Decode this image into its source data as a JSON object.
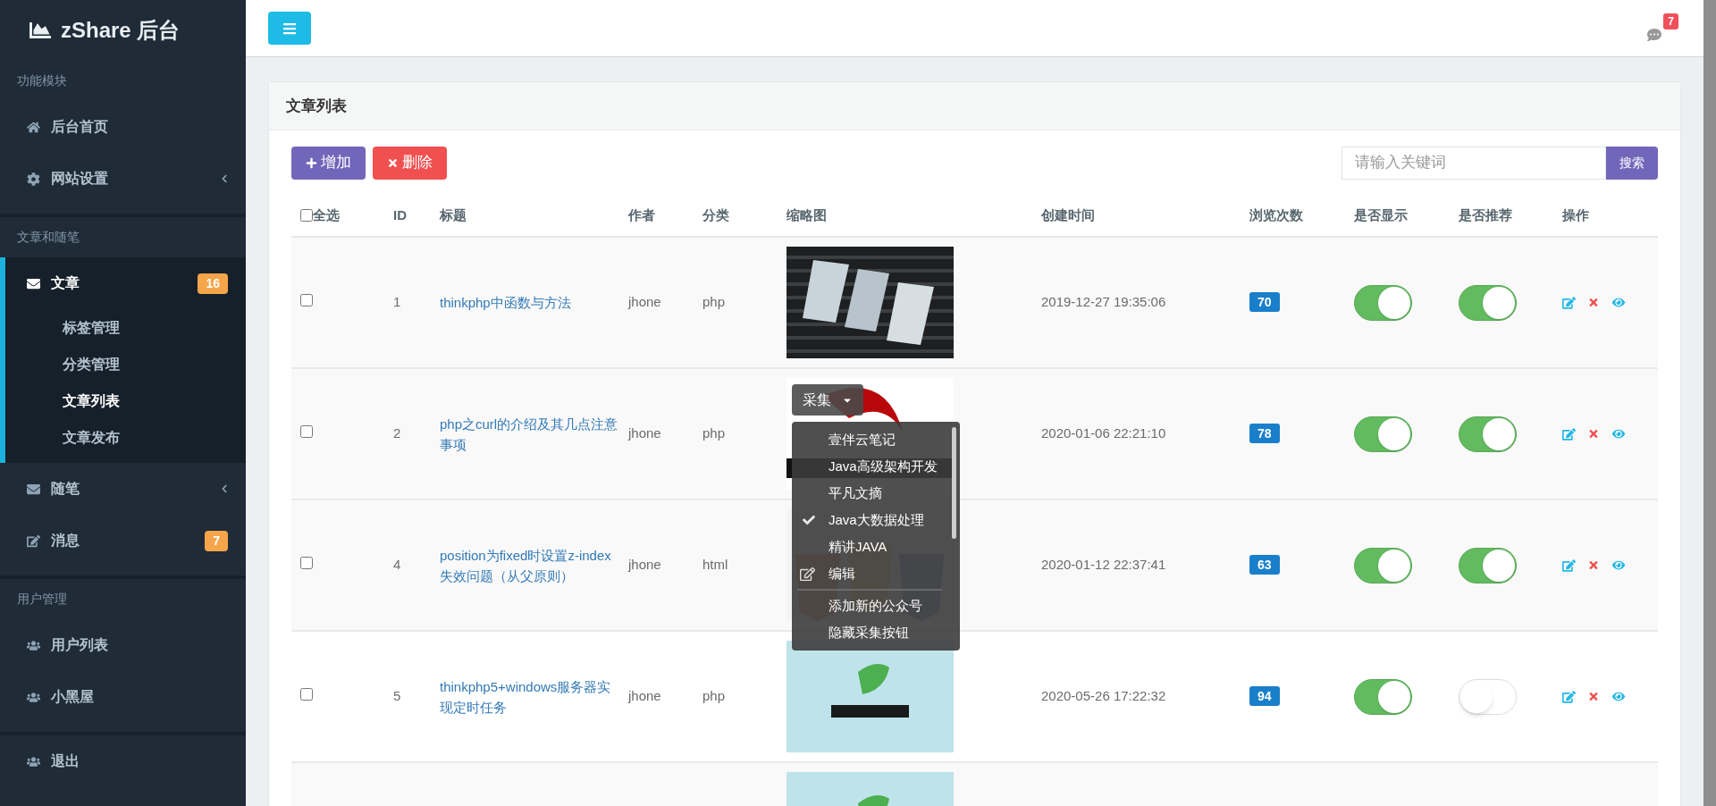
{
  "sidebar": {
    "logo": "zShare 后台",
    "sections": [
      {
        "label": "功能模块",
        "items": [
          {
            "label": "后台首页"
          },
          {
            "label": "网站设置",
            "expanded": false
          }
        ]
      },
      {
        "label": "文章和随笔",
        "items": [
          {
            "label": "文章",
            "expanded": true,
            "badge": "16",
            "children": [
              {
                "label": "标签管理",
                "selected": false
              },
              {
                "label": "分类管理",
                "selected": false
              },
              {
                "label": "文章列表",
                "selected": true
              },
              {
                "label": "文章发布",
                "selected": false
              }
            ]
          },
          {
            "label": "随笔",
            "expanded": false
          },
          {
            "label": "消息",
            "badge": "7"
          }
        ]
      },
      {
        "label": "用户管理",
        "items": [
          {
            "label": "用户列表"
          },
          {
            "label": "小黑屋"
          }
        ]
      },
      {
        "items": [
          {
            "label": "退出"
          }
        ]
      }
    ]
  },
  "header": {
    "message_count": "7"
  },
  "panel": {
    "title": "文章列表",
    "add_button": "增加",
    "delete_button": "删除",
    "search": {
      "placeholder": "请输入关键词",
      "button": "搜索"
    },
    "table": {
      "select_all": {
        "label": "全选",
        "checked": false
      },
      "columns": [
        "ID",
        "标题",
        "作者",
        "分类",
        "缩略图",
        "创建时间",
        "浏览次数",
        "是否显示",
        "是否推荐",
        "操作"
      ],
      "rows": [
        {
          "checked": false,
          "id": "1",
          "title": "thinkphp中函数与方法",
          "author": "jhone",
          "category": "php",
          "thumbnail": {
            "kind": "picture"
          },
          "created": "2019-12-27 19:35:06",
          "views": "70",
          "shown": true,
          "recommended": true
        },
        {
          "checked": false,
          "id": "2",
          "title": "php之curl的介绍及其几点注意事项",
          "author": "jhone",
          "category": "php",
          "thumbnail": {
            "kind": "picture"
          },
          "created": "2020-01-06 22:21:10",
          "views": "78",
          "shown": true,
          "recommended": true,
          "collect_menu": {
            "button": "采集",
            "expanded": true,
            "options": [
              {
                "label": "壹伴云笔记",
                "checked": false
              },
              {
                "label": "Java高级架构开发",
                "checked": false
              },
              {
                "label": "平凡文摘",
                "checked": false
              },
              {
                "label": "Java大数据处理",
                "checked": true
              },
              {
                "label": "精讲JAVA",
                "checked": false
              }
            ],
            "edit": "编辑",
            "actions": [
              "添加新的公众号",
              "隐藏采集按钮"
            ]
          }
        },
        {
          "checked": false,
          "id": "4",
          "title": "position为fixed时设置z-index失效问题（从父原则）",
          "author": "jhone",
          "category": "html",
          "thumbnail": {
            "kind": "picture"
          },
          "created": "2020-01-12 22:37:41",
          "views": "63",
          "shown": true,
          "recommended": true
        },
        {
          "checked": false,
          "id": "5",
          "title": "thinkphp5+windows服务器实现定时任务",
          "author": "jhone",
          "category": "php",
          "thumbnail": {
            "kind": "picture"
          },
          "created": "2020-05-26 17:22:32",
          "views": "94",
          "shown": true,
          "recommended": false
        },
        {
          "thumbnail": {
            "kind": "picture"
          }
        }
      ]
    }
  }
}
